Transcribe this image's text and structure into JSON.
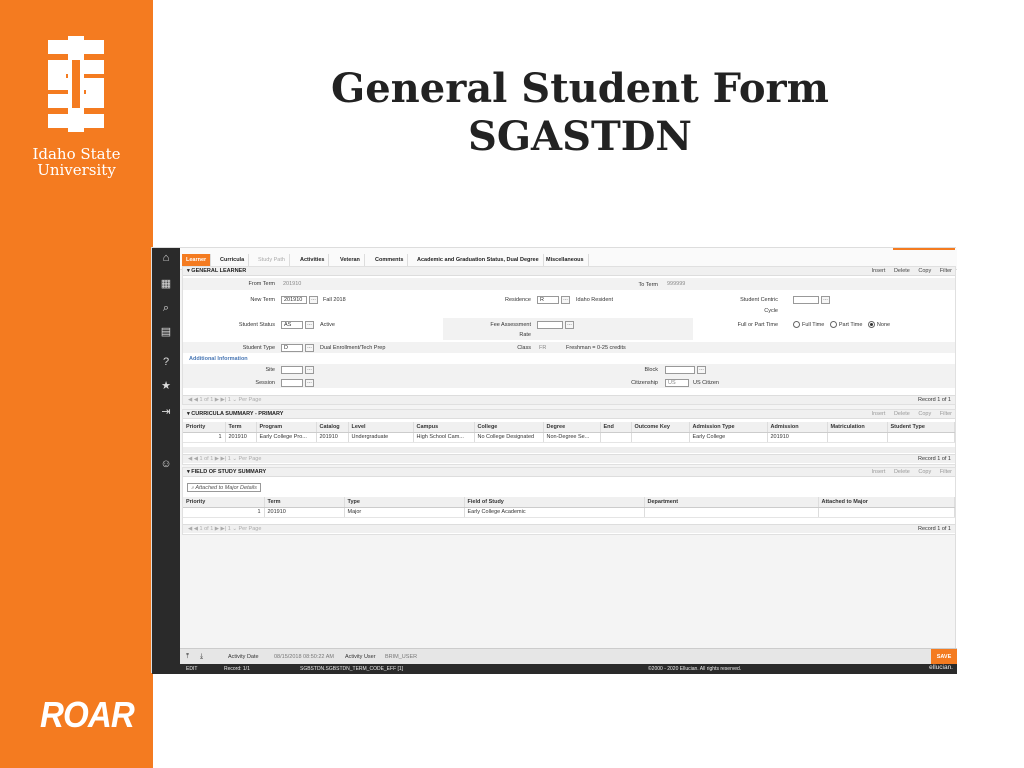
{
  "slide": {
    "title_line1": "General Student Form",
    "title_line2": "SGASTDN",
    "university_line1": "Idaho State",
    "university_line2": "University",
    "brand_word": "ROAR"
  },
  "nav": {
    "icons": [
      "home-icon",
      "grid-icon",
      "search-icon",
      "folder-icon",
      "help-icon",
      "star-icon",
      "sign-out-icon",
      "users-icon"
    ]
  },
  "tabs": [
    {
      "label": "Learner"
    },
    {
      "label": "Curricula"
    },
    {
      "label": "Study Path"
    },
    {
      "label": "Activities"
    },
    {
      "label": "Veteran"
    },
    {
      "label": "Comments"
    },
    {
      "label": "Academic and Graduation Status, Dual Degree"
    },
    {
      "label": "Miscellaneous"
    }
  ],
  "actions": {
    "insert": "Insert",
    "delete": "Delete",
    "copy": "Copy",
    "filter": "Filter"
  },
  "general": {
    "title": "GENERAL LEARNER",
    "from_term_label": "From Term",
    "from_term": "201910",
    "to_term_label": "To Term",
    "to_term": "999999",
    "new_term_label": "New Term",
    "new_term": "201910",
    "new_term_desc": "Fall 2018",
    "residence_label": "Residence",
    "residence": "R",
    "residence_desc": "Idaho Resident",
    "student_centric_label": "Student Centric",
    "cycle_label": "Cycle",
    "student_status_label": "Student Status",
    "student_status": "AS",
    "student_status_desc": "Active",
    "fee_assessment_label": "Fee Assessment",
    "rate_label": "Rate",
    "full_part_label": "Full or Part Time",
    "full_time": "Full Time",
    "part_time": "Part Time",
    "none": "None",
    "student_type_label": "Student Type",
    "student_type": "D",
    "student_type_desc": "Dual Enrollment/Tech Prep",
    "class_label": "Class",
    "class_code": "FR",
    "class_desc": "Freshman = 0-25 credits",
    "additional_info": "Additional Information",
    "site_label": "Site",
    "block_label": "Block",
    "session_label": "Session",
    "citizenship_label": "Citizenship",
    "citizenship": "US",
    "citizenship_desc": "US Citizen",
    "pager": "◀  ◀  1 of 1  ▶  ▶|        1  ⌄  Per Page",
    "record": "Record 1 of 1"
  },
  "curricula": {
    "title": "CURRICULA SUMMARY - PRIMARY",
    "columns": [
      "Priority",
      "Term",
      "Program",
      "Catalog",
      "Level",
      "Campus",
      "College",
      "Degree",
      "End",
      "Outcome Key",
      "Admission Type",
      "Admission",
      "Matriculation",
      "Student Type"
    ],
    "rows": [
      [
        "1",
        "201910",
        "Early College Pro...",
        "201910",
        "Undergraduate",
        "High School Cam...",
        "No College Designated",
        "Non-Degree Se...",
        "",
        "",
        "Early College",
        "201910",
        "",
        ""
      ]
    ],
    "pager": "◀  ◀  1 of 1  ▶  ▶|        1  ⌄  Per Page",
    "record": "Record 1 of 1"
  },
  "field_of_study": {
    "title": "FIELD OF STUDY SUMMARY",
    "attached_button": "Attached to Major Details",
    "columns": [
      "Priority",
      "Term",
      "Type",
      "Field of Study",
      "Department",
      "Attached to Major"
    ],
    "rows": [
      [
        "1",
        "201910",
        "Major",
        "Early College Academic",
        "",
        ""
      ]
    ],
    "pager": "◀  ◀  1 of 1  ▶  ▶|        1  ⌄  Per Page",
    "record": "Record 1 of 1"
  },
  "footer": {
    "activity_date_label": "Activity Date",
    "activity_date": "08/15/2018 08:50:22 AM",
    "activity_user_label": "Activity User",
    "activity_user": "BRIM_USER",
    "save": "SAVE"
  },
  "status": {
    "mode": "EDIT",
    "record": "Record: 1/1",
    "field": "SGBSTDN.SGBSTDN_TERM_CODE_EFF [1]",
    "copyright": "©2000 - 2020 Ellucian. All rights reserved.",
    "brand": "ellucian."
  },
  "colors": {
    "accent": "#f47b20"
  }
}
